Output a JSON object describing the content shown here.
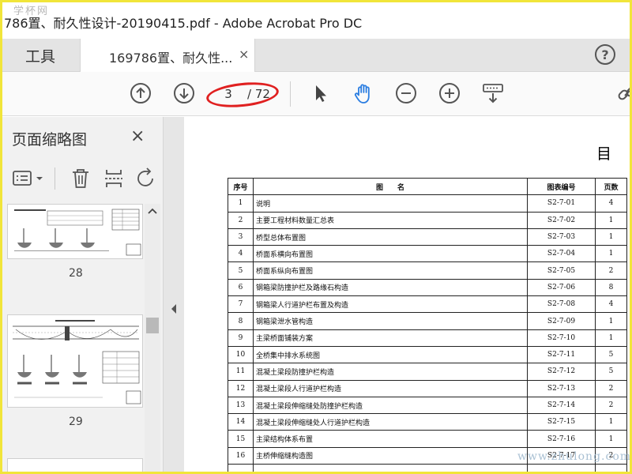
{
  "window": {
    "title": "786置、耐久性设计-20190415.pdf - Adobe Acrobat Pro DC",
    "watermark": "学杯网"
  },
  "tabs": {
    "tools": "工具",
    "document": "169786置、耐久性...",
    "close": "×",
    "help": "?"
  },
  "toolbar": {
    "page_current": "3",
    "page_total": "/ 72"
  },
  "sidebar": {
    "title": "页面缩略图",
    "close": "×",
    "thumbnails": [
      {
        "label": "28"
      },
      {
        "label": "29"
      }
    ]
  },
  "document": {
    "heading": "目",
    "table": {
      "headers": [
        "序号",
        "图　　名",
        "图表编号",
        "页数"
      ],
      "rows": [
        [
          "1",
          "说明",
          "S2-7-01",
          "4"
        ],
        [
          "2",
          "主要工程材料数量汇总表",
          "S2-7-02",
          "1"
        ],
        [
          "3",
          "桥型总体布置图",
          "S2-7-03",
          "1"
        ],
        [
          "4",
          "桥面系横向布置图",
          "S2-7-04",
          "1"
        ],
        [
          "5",
          "桥面系纵向布置图",
          "S2-7-05",
          "2"
        ],
        [
          "6",
          "钢箱梁防撞护栏及路缘石构造",
          "S2-7-06",
          "8"
        ],
        [
          "7",
          "钢箱梁人行道护栏布置及构造",
          "S2-7-08",
          "4"
        ],
        [
          "8",
          "钢箱梁泄水管构造",
          "S2-7-09",
          "1"
        ],
        [
          "9",
          "主梁桥面铺装方案",
          "S2-7-10",
          "1"
        ],
        [
          "10",
          "全桥集中排水系统图",
          "S2-7-11",
          "5"
        ],
        [
          "11",
          "混凝土梁段防撞护栏构造",
          "S2-7-12",
          "5"
        ],
        [
          "12",
          "混凝土梁段人行道护栏构造",
          "S2-7-13",
          "2"
        ],
        [
          "13",
          "混凝土梁段伸缩缝处防撞护栏构造",
          "S2-7-14",
          "2"
        ],
        [
          "14",
          "混凝土梁段伸缩缝处人行道护栏构造",
          "S2-7-15",
          "1"
        ],
        [
          "15",
          "主梁结构体系布置",
          "S2-7-16",
          "1"
        ],
        [
          "16",
          "主桥伸缩缝构造图",
          "S2-7-17",
          "2"
        ],
        [
          "",
          "",
          "",
          ""
        ]
      ]
    },
    "watermark": "www.zhulong.com"
  },
  "colors": {
    "frame": "#f1e53a",
    "active_icon": "#2a7de1",
    "ellipse": "#e02020"
  }
}
